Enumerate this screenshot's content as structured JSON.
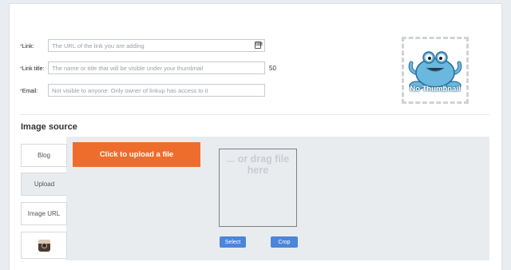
{
  "form": {
    "link": {
      "required_mark": "*",
      "label": "Link:",
      "placeholder": "The URL of the link you are adding"
    },
    "link_title": {
      "required_mark": "*",
      "label": "Link title:",
      "placeholder": "The name or title that will be visible under your thumbnail",
      "counter": "50"
    },
    "email": {
      "required_mark": "*",
      "label": "Email:",
      "placeholder": "Not visible to anyone. Only owner of linkup has access to it"
    }
  },
  "thumbnail": {
    "label": "No Thumbnail"
  },
  "image_source": {
    "title": "Image source",
    "tabs": [
      {
        "label": "Blog"
      },
      {
        "label": "Upload",
        "active": true
      },
      {
        "label": "Image URL"
      },
      {
        "label": "",
        "icon": "instagram-icon"
      }
    ],
    "upload_button": "Click to upload a file",
    "drop_text": "... or drag file here",
    "select_button": "Select",
    "crop_button": "Crop"
  },
  "colors": {
    "accent": "#ef6d2c",
    "button_blue": "#4b86d8",
    "required": "#d0342c",
    "mascot": "#6ab7e0"
  }
}
